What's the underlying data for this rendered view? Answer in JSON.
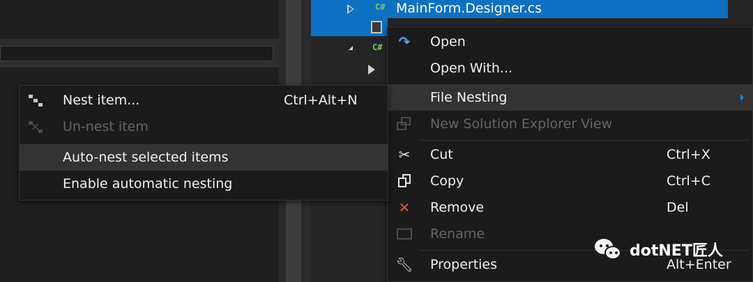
{
  "solution_explorer": {
    "nodes": [
      {
        "label": "MainForm.Designer.cs",
        "icon": "csharp-file-icon",
        "selected": true
      },
      {
        "label": "",
        "icon": "resource-file-icon",
        "selected": true
      },
      {
        "label": "",
        "icon": "csharp-file-icon",
        "selected": false
      },
      {
        "label": "",
        "icon": "expand-arrow-icon",
        "selected": false
      }
    ]
  },
  "context_menu": {
    "items": [
      {
        "label": "Open",
        "shortcut": "",
        "icon": "open-arrow-icon",
        "enabled": true
      },
      {
        "label": "Open With...",
        "shortcut": "",
        "icon": "",
        "enabled": true
      },
      {
        "label": "File Nesting",
        "shortcut": "",
        "icon": "",
        "enabled": true,
        "submenu": true
      },
      {
        "label": "New Solution Explorer View",
        "shortcut": "",
        "icon": "new-view-icon",
        "enabled": false
      },
      {
        "label": "Cut",
        "shortcut": "Ctrl+X",
        "icon": "scissors-icon",
        "enabled": true
      },
      {
        "label": "Copy",
        "shortcut": "Ctrl+C",
        "icon": "copy-icon",
        "enabled": true
      },
      {
        "label": "Remove",
        "shortcut": "Del",
        "icon": "remove-x-icon",
        "enabled": true
      },
      {
        "label": "Rename",
        "shortcut": "",
        "icon": "rename-icon",
        "enabled": false
      },
      {
        "label": "Properties",
        "shortcut": "Alt+Enter",
        "icon": "wrench-icon",
        "enabled": true
      }
    ]
  },
  "file_nesting_submenu": {
    "items": [
      {
        "label": "Nest item...",
        "shortcut": "Ctrl+Alt+N",
        "icon": "nest-item-icon",
        "enabled": true
      },
      {
        "label": "Un-nest item",
        "shortcut": "",
        "icon": "unnest-item-icon",
        "enabled": false
      },
      {
        "label": "Auto-nest selected items",
        "shortcut": "",
        "icon": "",
        "enabled": true
      },
      {
        "label": "Enable automatic nesting",
        "shortcut": "",
        "icon": "",
        "enabled": true
      }
    ]
  },
  "watermark": {
    "text": "dotNET匠人",
    "icon": "wechat-logo-icon"
  },
  "colors": {
    "selection": "#0e70c0",
    "menu_background": "#1b1b1c",
    "menu_hover": "#333334",
    "disabled_text": "#656565",
    "remove_icon": "#e8533a",
    "open_icon": "#5aa0e6",
    "submenu_arrow": "#1e8ad6"
  }
}
